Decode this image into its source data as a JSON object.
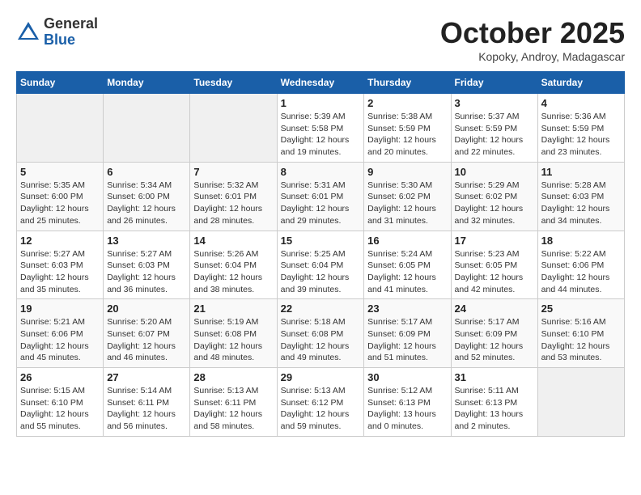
{
  "logo": {
    "general": "General",
    "blue": "Blue"
  },
  "title": "October 2025",
  "subtitle": "Kopoky, Androy, Madagascar",
  "days_of_week": [
    "Sunday",
    "Monday",
    "Tuesday",
    "Wednesday",
    "Thursday",
    "Friday",
    "Saturday"
  ],
  "weeks": [
    [
      {
        "day": "",
        "info": ""
      },
      {
        "day": "",
        "info": ""
      },
      {
        "day": "",
        "info": ""
      },
      {
        "day": "1",
        "sunrise": "Sunrise: 5:39 AM",
        "sunset": "Sunset: 5:58 PM",
        "daylight": "Daylight: 12 hours and 19 minutes."
      },
      {
        "day": "2",
        "sunrise": "Sunrise: 5:38 AM",
        "sunset": "Sunset: 5:59 PM",
        "daylight": "Daylight: 12 hours and 20 minutes."
      },
      {
        "day": "3",
        "sunrise": "Sunrise: 5:37 AM",
        "sunset": "Sunset: 5:59 PM",
        "daylight": "Daylight: 12 hours and 22 minutes."
      },
      {
        "day": "4",
        "sunrise": "Sunrise: 5:36 AM",
        "sunset": "Sunset: 5:59 PM",
        "daylight": "Daylight: 12 hours and 23 minutes."
      }
    ],
    [
      {
        "day": "5",
        "sunrise": "Sunrise: 5:35 AM",
        "sunset": "Sunset: 6:00 PM",
        "daylight": "Daylight: 12 hours and 25 minutes."
      },
      {
        "day": "6",
        "sunrise": "Sunrise: 5:34 AM",
        "sunset": "Sunset: 6:00 PM",
        "daylight": "Daylight: 12 hours and 26 minutes."
      },
      {
        "day": "7",
        "sunrise": "Sunrise: 5:32 AM",
        "sunset": "Sunset: 6:01 PM",
        "daylight": "Daylight: 12 hours and 28 minutes."
      },
      {
        "day": "8",
        "sunrise": "Sunrise: 5:31 AM",
        "sunset": "Sunset: 6:01 PM",
        "daylight": "Daylight: 12 hours and 29 minutes."
      },
      {
        "day": "9",
        "sunrise": "Sunrise: 5:30 AM",
        "sunset": "Sunset: 6:02 PM",
        "daylight": "Daylight: 12 hours and 31 minutes."
      },
      {
        "day": "10",
        "sunrise": "Sunrise: 5:29 AM",
        "sunset": "Sunset: 6:02 PM",
        "daylight": "Daylight: 12 hours and 32 minutes."
      },
      {
        "day": "11",
        "sunrise": "Sunrise: 5:28 AM",
        "sunset": "Sunset: 6:03 PM",
        "daylight": "Daylight: 12 hours and 34 minutes."
      }
    ],
    [
      {
        "day": "12",
        "sunrise": "Sunrise: 5:27 AM",
        "sunset": "Sunset: 6:03 PM",
        "daylight": "Daylight: 12 hours and 35 minutes."
      },
      {
        "day": "13",
        "sunrise": "Sunrise: 5:27 AM",
        "sunset": "Sunset: 6:03 PM",
        "daylight": "Daylight: 12 hours and 36 minutes."
      },
      {
        "day": "14",
        "sunrise": "Sunrise: 5:26 AM",
        "sunset": "Sunset: 6:04 PM",
        "daylight": "Daylight: 12 hours and 38 minutes."
      },
      {
        "day": "15",
        "sunrise": "Sunrise: 5:25 AM",
        "sunset": "Sunset: 6:04 PM",
        "daylight": "Daylight: 12 hours and 39 minutes."
      },
      {
        "day": "16",
        "sunrise": "Sunrise: 5:24 AM",
        "sunset": "Sunset: 6:05 PM",
        "daylight": "Daylight: 12 hours and 41 minutes."
      },
      {
        "day": "17",
        "sunrise": "Sunrise: 5:23 AM",
        "sunset": "Sunset: 6:05 PM",
        "daylight": "Daylight: 12 hours and 42 minutes."
      },
      {
        "day": "18",
        "sunrise": "Sunrise: 5:22 AM",
        "sunset": "Sunset: 6:06 PM",
        "daylight": "Daylight: 12 hours and 44 minutes."
      }
    ],
    [
      {
        "day": "19",
        "sunrise": "Sunrise: 5:21 AM",
        "sunset": "Sunset: 6:06 PM",
        "daylight": "Daylight: 12 hours and 45 minutes."
      },
      {
        "day": "20",
        "sunrise": "Sunrise: 5:20 AM",
        "sunset": "Sunset: 6:07 PM",
        "daylight": "Daylight: 12 hours and 46 minutes."
      },
      {
        "day": "21",
        "sunrise": "Sunrise: 5:19 AM",
        "sunset": "Sunset: 6:08 PM",
        "daylight": "Daylight: 12 hours and 48 minutes."
      },
      {
        "day": "22",
        "sunrise": "Sunrise: 5:18 AM",
        "sunset": "Sunset: 6:08 PM",
        "daylight": "Daylight: 12 hours and 49 minutes."
      },
      {
        "day": "23",
        "sunrise": "Sunrise: 5:17 AM",
        "sunset": "Sunset: 6:09 PM",
        "daylight": "Daylight: 12 hours and 51 minutes."
      },
      {
        "day": "24",
        "sunrise": "Sunrise: 5:17 AM",
        "sunset": "Sunset: 6:09 PM",
        "daylight": "Daylight: 12 hours and 52 minutes."
      },
      {
        "day": "25",
        "sunrise": "Sunrise: 5:16 AM",
        "sunset": "Sunset: 6:10 PM",
        "daylight": "Daylight: 12 hours and 53 minutes."
      }
    ],
    [
      {
        "day": "26",
        "sunrise": "Sunrise: 5:15 AM",
        "sunset": "Sunset: 6:10 PM",
        "daylight": "Daylight: 12 hours and 55 minutes."
      },
      {
        "day": "27",
        "sunrise": "Sunrise: 5:14 AM",
        "sunset": "Sunset: 6:11 PM",
        "daylight": "Daylight: 12 hours and 56 minutes."
      },
      {
        "day": "28",
        "sunrise": "Sunrise: 5:13 AM",
        "sunset": "Sunset: 6:11 PM",
        "daylight": "Daylight: 12 hours and 58 minutes."
      },
      {
        "day": "29",
        "sunrise": "Sunrise: 5:13 AM",
        "sunset": "Sunset: 6:12 PM",
        "daylight": "Daylight: 12 hours and 59 minutes."
      },
      {
        "day": "30",
        "sunrise": "Sunrise: 5:12 AM",
        "sunset": "Sunset: 6:13 PM",
        "daylight": "Daylight: 13 hours and 0 minutes."
      },
      {
        "day": "31",
        "sunrise": "Sunrise: 5:11 AM",
        "sunset": "Sunset: 6:13 PM",
        "daylight": "Daylight: 13 hours and 2 minutes."
      },
      {
        "day": "",
        "info": ""
      }
    ]
  ]
}
